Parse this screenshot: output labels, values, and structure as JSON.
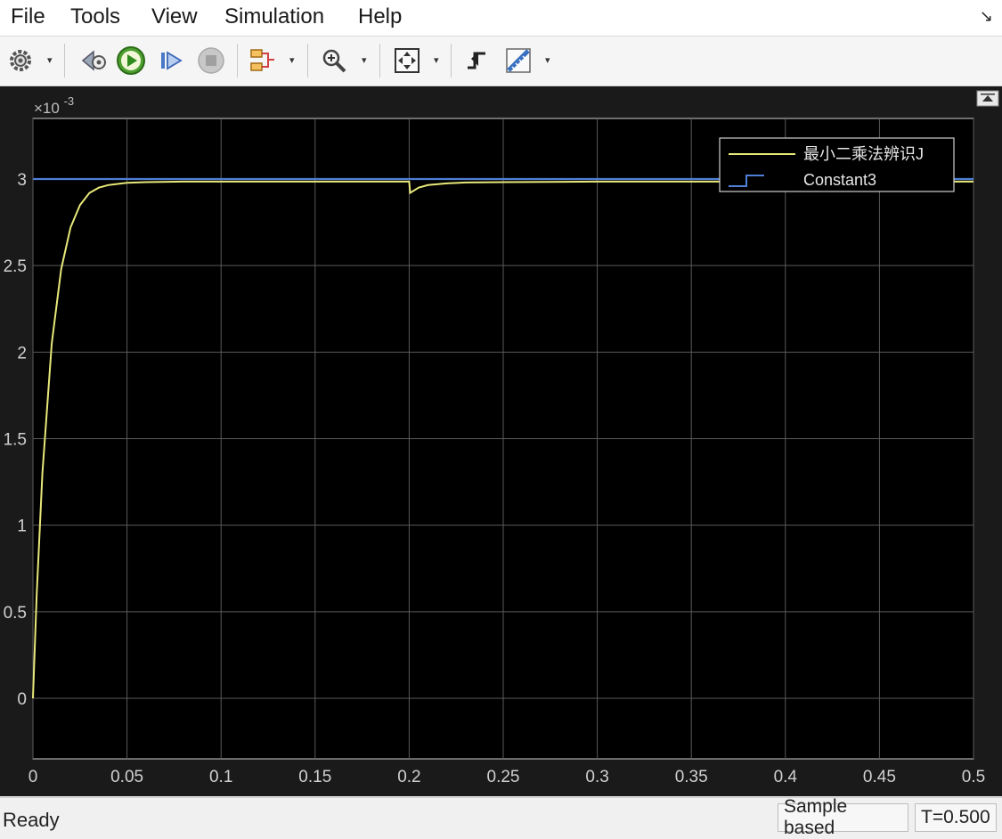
{
  "menu": {
    "items": [
      "File",
      "Tools",
      "View",
      "Simulation",
      "Help"
    ]
  },
  "toolbar": {
    "buttons": [
      {
        "icon": "gear-icon",
        "has_dropdown": true
      },
      {
        "icon": "step-back-icon",
        "has_dropdown": false
      },
      {
        "icon": "run-icon",
        "has_dropdown": false
      },
      {
        "icon": "step-forward-icon",
        "has_dropdown": false
      },
      {
        "icon": "stop-icon",
        "has_dropdown": false
      },
      {
        "icon": "highlight-icon",
        "has_dropdown": true
      },
      {
        "icon": "zoom-icon",
        "has_dropdown": true
      },
      {
        "icon": "autoscale-icon",
        "has_dropdown": true
      },
      {
        "icon": "triggers-icon",
        "has_dropdown": false
      },
      {
        "icon": "cursor-measure-icon",
        "has_dropdown": true
      }
    ]
  },
  "scope": {
    "background": "#000000",
    "frame_background": "#1a1a1a",
    "grid_color": "#5a5a5a",
    "tick_color": "#d0d0d0",
    "exponent_label": "×10",
    "exponent_power": "-3"
  },
  "chart_data": {
    "type": "line",
    "xlim": [
      0,
      0.5
    ],
    "ylim": [
      -0.35,
      3.35
    ],
    "y_scale_note": "×10^-3",
    "xticks": [
      "0",
      "0.05",
      "0.1",
      "0.15",
      "0.2",
      "0.25",
      "0.3",
      "0.35",
      "0.4",
      "0.45",
      "0.5"
    ],
    "yticks": [
      "0",
      "0.5",
      "1",
      "1.5",
      "2",
      "2.5",
      "3"
    ],
    "grid": true,
    "legend_position": "top-right",
    "series": [
      {
        "name": "最小二乘法辨识J",
        "color": "#e8e87a",
        "x": [
          0,
          0.002,
          0.005,
          0.01,
          0.015,
          0.02,
          0.025,
          0.03,
          0.035,
          0.04,
          0.05,
          0.06,
          0.08,
          0.1,
          0.15,
          0.2,
          0.2005,
          0.205,
          0.21,
          0.22,
          0.23,
          0.25,
          0.3,
          0.4,
          0.5
        ],
        "values": [
          0,
          0.6,
          1.3,
          2.05,
          2.48,
          2.72,
          2.85,
          2.92,
          2.95,
          2.965,
          2.978,
          2.982,
          2.985,
          2.985,
          2.985,
          2.985,
          2.92,
          2.95,
          2.965,
          2.975,
          2.98,
          2.982,
          2.985,
          2.985,
          2.985
        ]
      },
      {
        "name": "Constant3",
        "color": "#4f7fd6",
        "x": [
          0,
          0.5
        ],
        "values": [
          3.0,
          3.0
        ]
      }
    ]
  },
  "status": {
    "left": "Ready",
    "mode": "Sample based",
    "time": "T=0.500"
  }
}
